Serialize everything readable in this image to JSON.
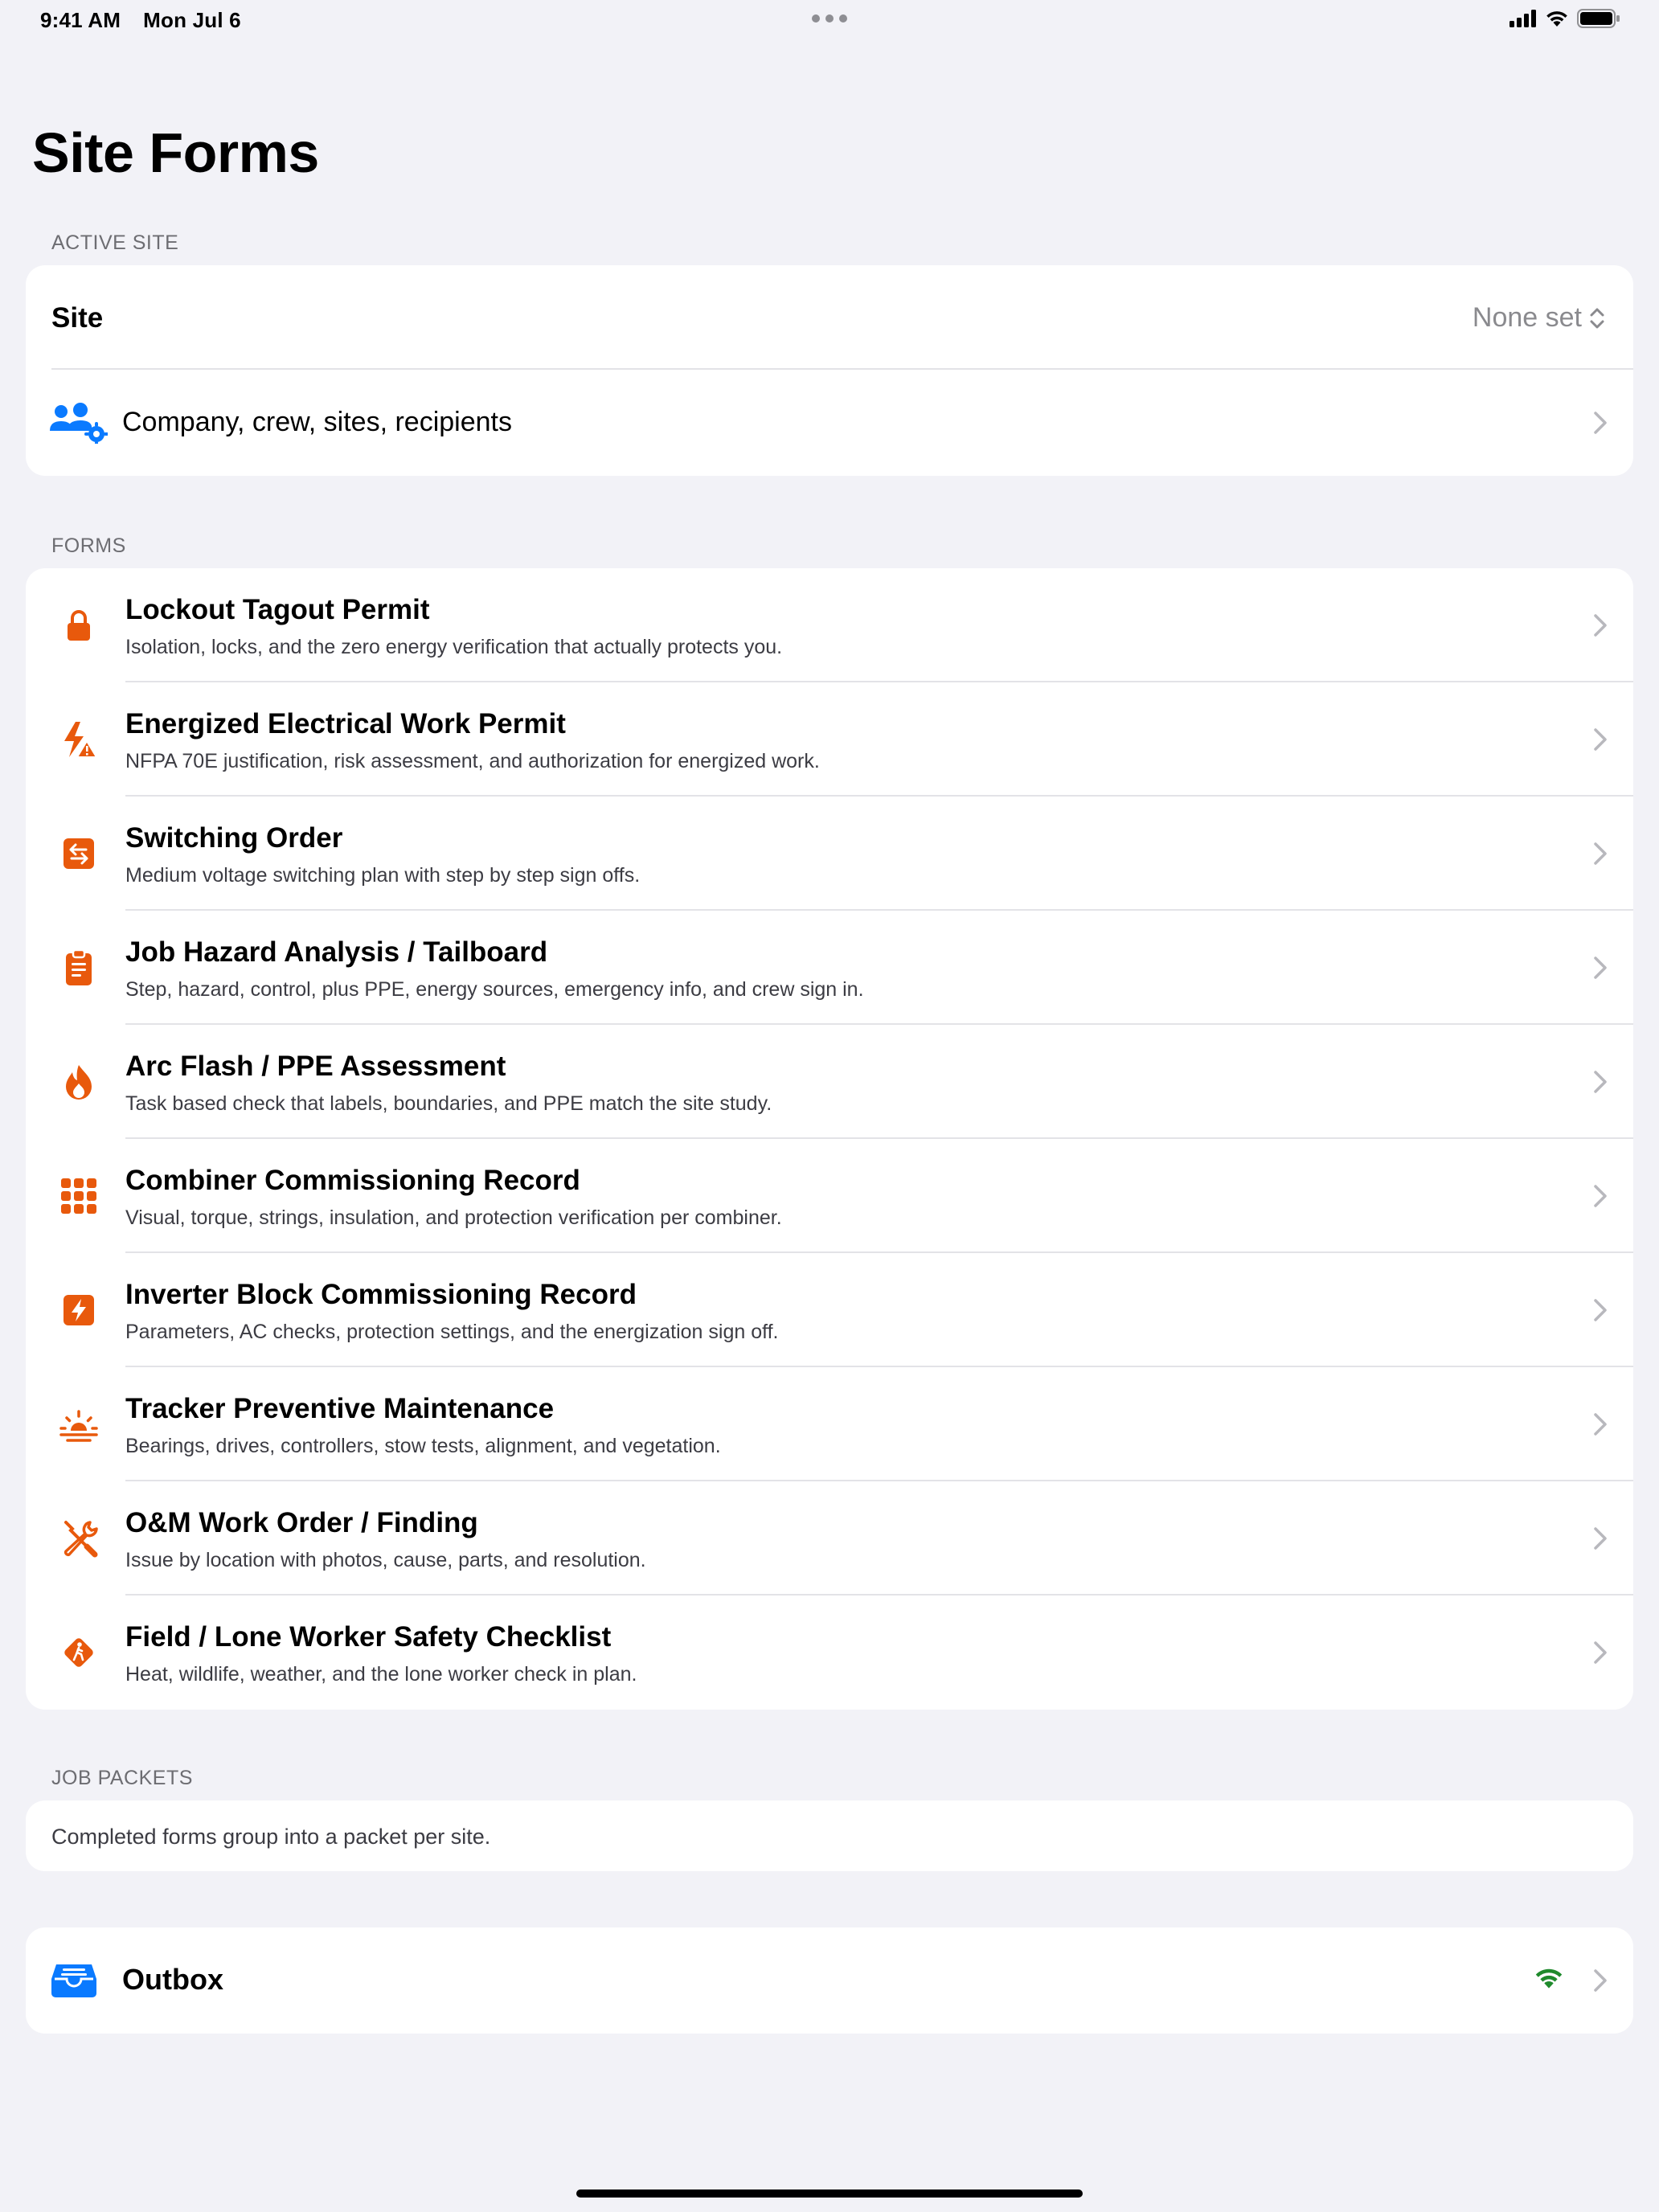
{
  "status_bar": {
    "time": "9:41 AM",
    "date": "Mon Jul 6"
  },
  "title": "Site Forms",
  "active_site": {
    "header": "ACTIVE SITE",
    "site_label": "Site",
    "site_value": "None set",
    "company_label": "Company, crew, sites, recipients"
  },
  "forms": {
    "header": "FORMS",
    "items": [
      {
        "title": "Lockout Tagout Permit",
        "subtitle": "Isolation, locks, and the zero energy verification that actually protects you.",
        "icon": "lock-icon"
      },
      {
        "title": "Energized Electrical Work Permit",
        "subtitle": "NFPA 70E justification, risk assessment, and authorization for energized work.",
        "icon": "bolt-warning-icon"
      },
      {
        "title": "Switching Order",
        "subtitle": "Medium voltage switching plan with step by step sign offs.",
        "icon": "switch-arrows-icon"
      },
      {
        "title": "Job Hazard Analysis / Tailboard",
        "subtitle": "Step, hazard, control, plus PPE, energy sources, emergency info, and crew sign in.",
        "icon": "clipboard-icon"
      },
      {
        "title": "Arc Flash / PPE Assessment",
        "subtitle": "Task based check that labels, boundaries, and PPE match the site study.",
        "icon": "flame-icon"
      },
      {
        "title": "Combiner Commissioning Record",
        "subtitle": "Visual, torque, strings, insulation, and protection verification per combiner.",
        "icon": "grid-icon"
      },
      {
        "title": "Inverter Block Commissioning Record",
        "subtitle": "Parameters, AC checks, protection settings, and the energization sign off.",
        "icon": "bolt-square-icon"
      },
      {
        "title": "Tracker Preventive Maintenance",
        "subtitle": "Bearings, drives, controllers, stow tests, alignment, and vegetation.",
        "icon": "sunrise-icon"
      },
      {
        "title": "O&M Work Order / Finding",
        "subtitle": "Issue by location with photos, cause, parts, and resolution.",
        "icon": "wrench-screwdriver-icon"
      },
      {
        "title": "Field / Lone Worker Safety Checklist",
        "subtitle": "Heat, wildlife, weather, and the lone worker check in plan.",
        "icon": "walker-sign-icon"
      }
    ]
  },
  "job_packets": {
    "header": "JOB PACKETS",
    "text": "Completed forms group into a packet per site."
  },
  "outbox": {
    "label": "Outbox"
  },
  "colors": {
    "accent_orange": "#e8590c",
    "accent_blue": "#0a7aff",
    "online_green": "#1f8a2c",
    "background": "#f2f2f7"
  }
}
